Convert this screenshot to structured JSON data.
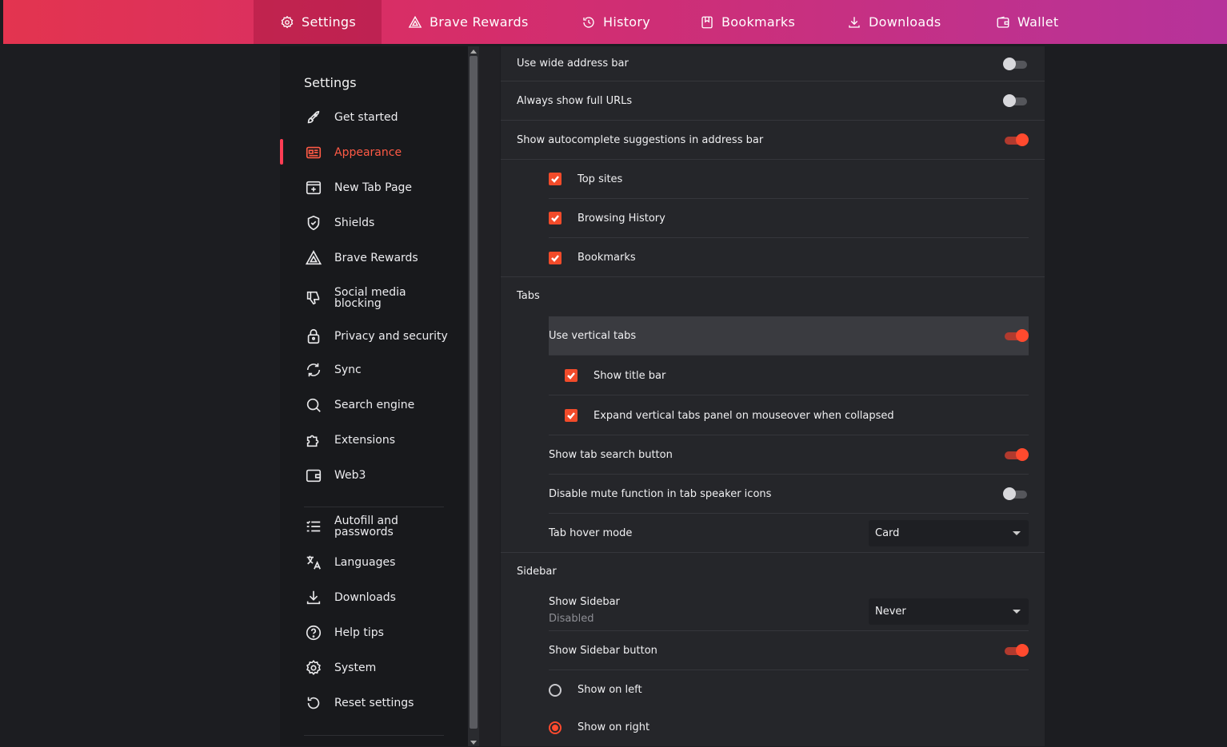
{
  "topbar": {
    "tabs": [
      {
        "label": "Settings",
        "icon": "gear-icon",
        "active": true
      },
      {
        "label": "Brave Rewards",
        "icon": "rewards-triangle-icon"
      },
      {
        "label": "History",
        "icon": "history-icon"
      },
      {
        "label": "Bookmarks",
        "icon": "bookmark-icon"
      },
      {
        "label": "Downloads",
        "icon": "download-icon"
      },
      {
        "label": "Wallet",
        "icon": "wallet-icon"
      }
    ]
  },
  "menu": {
    "title": "Settings",
    "items": [
      {
        "label": "Get started",
        "icon": "rocket-icon"
      },
      {
        "label": "Appearance",
        "icon": "appearance-icon",
        "active": true
      },
      {
        "label": "New Tab Page",
        "icon": "new-tab-icon"
      },
      {
        "label": "Shields",
        "icon": "shield-icon"
      },
      {
        "label": "Brave Rewards",
        "icon": "rewards-triangle-icon"
      },
      {
        "label": "Social media blocking",
        "icon": "thumbs-down-icon"
      },
      {
        "label": "Privacy and security",
        "icon": "lock-icon"
      },
      {
        "label": "Sync",
        "icon": "sync-icon"
      },
      {
        "label": "Search engine",
        "icon": "search-icon"
      },
      {
        "label": "Extensions",
        "icon": "puzzle-icon"
      },
      {
        "label": "Web3",
        "icon": "wallet-icon"
      },
      {
        "label": "Autofill and passwords",
        "icon": "list-icon"
      },
      {
        "label": "Languages",
        "icon": "translate-icon"
      },
      {
        "label": "Downloads",
        "icon": "download-icon"
      },
      {
        "label": "Help tips",
        "icon": "help-icon"
      },
      {
        "label": "System",
        "icon": "gear-icon"
      },
      {
        "label": "Reset settings",
        "icon": "reset-icon"
      }
    ]
  },
  "main": {
    "wide_address_bar": {
      "label": "Use wide address bar",
      "on": false
    },
    "full_urls": {
      "label": "Always show full URLs",
      "on": false
    },
    "autocomplete": {
      "label": "Show autocomplete suggestions in address bar",
      "on": true
    },
    "top_sites": {
      "label": "Top sites",
      "checked": true
    },
    "browsing_history": {
      "label": "Browsing History",
      "checked": true
    },
    "bookmarks": {
      "label": "Bookmarks",
      "checked": true
    },
    "tabs_section": "Tabs",
    "vertical_tabs": {
      "label": "Use vertical tabs",
      "on": true
    },
    "show_title_bar": {
      "label": "Show title bar",
      "checked": true
    },
    "expand_vertical": {
      "label": "Expand vertical tabs panel on mouseover when collapsed",
      "checked": true
    },
    "tab_search_button": {
      "label": "Show tab search button",
      "on": true
    },
    "disable_mute": {
      "label": "Disable mute function in tab speaker icons",
      "on": false
    },
    "tab_hover_mode": {
      "label": "Tab hover mode",
      "value": "Card"
    },
    "sidebar_section": "Sidebar",
    "show_sidebar": {
      "label": "Show Sidebar",
      "sub": "Disabled",
      "value": "Never"
    },
    "show_sidebar_button": {
      "label": "Show Sidebar button",
      "on": true
    },
    "show_on_left": {
      "label": "Show on left",
      "selected": false
    },
    "show_on_right": {
      "label": "Show on right",
      "selected": true
    }
  },
  "colors": {
    "accent": "#ff4a2e",
    "active_menu": "#ff5a45"
  }
}
